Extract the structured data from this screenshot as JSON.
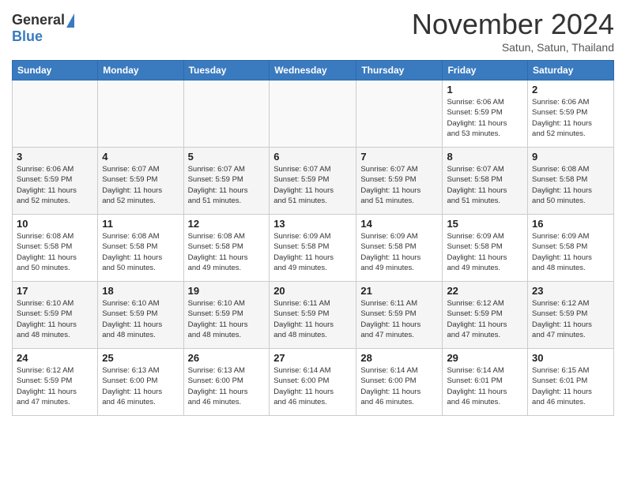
{
  "header": {
    "logo_general": "General",
    "logo_blue": "Blue",
    "month_title": "November 2024",
    "subtitle": "Satun, Satun, Thailand"
  },
  "weekdays": [
    "Sunday",
    "Monday",
    "Tuesday",
    "Wednesday",
    "Thursday",
    "Friday",
    "Saturday"
  ],
  "weeks": [
    [
      {
        "num": "",
        "info": ""
      },
      {
        "num": "",
        "info": ""
      },
      {
        "num": "",
        "info": ""
      },
      {
        "num": "",
        "info": ""
      },
      {
        "num": "",
        "info": ""
      },
      {
        "num": "1",
        "info": "Sunrise: 6:06 AM\nSunset: 5:59 PM\nDaylight: 11 hours\nand 53 minutes."
      },
      {
        "num": "2",
        "info": "Sunrise: 6:06 AM\nSunset: 5:59 PM\nDaylight: 11 hours\nand 52 minutes."
      }
    ],
    [
      {
        "num": "3",
        "info": "Sunrise: 6:06 AM\nSunset: 5:59 PM\nDaylight: 11 hours\nand 52 minutes."
      },
      {
        "num": "4",
        "info": "Sunrise: 6:07 AM\nSunset: 5:59 PM\nDaylight: 11 hours\nand 52 minutes."
      },
      {
        "num": "5",
        "info": "Sunrise: 6:07 AM\nSunset: 5:59 PM\nDaylight: 11 hours\nand 51 minutes."
      },
      {
        "num": "6",
        "info": "Sunrise: 6:07 AM\nSunset: 5:59 PM\nDaylight: 11 hours\nand 51 minutes."
      },
      {
        "num": "7",
        "info": "Sunrise: 6:07 AM\nSunset: 5:59 PM\nDaylight: 11 hours\nand 51 minutes."
      },
      {
        "num": "8",
        "info": "Sunrise: 6:07 AM\nSunset: 5:58 PM\nDaylight: 11 hours\nand 51 minutes."
      },
      {
        "num": "9",
        "info": "Sunrise: 6:08 AM\nSunset: 5:58 PM\nDaylight: 11 hours\nand 50 minutes."
      }
    ],
    [
      {
        "num": "10",
        "info": "Sunrise: 6:08 AM\nSunset: 5:58 PM\nDaylight: 11 hours\nand 50 minutes."
      },
      {
        "num": "11",
        "info": "Sunrise: 6:08 AM\nSunset: 5:58 PM\nDaylight: 11 hours\nand 50 minutes."
      },
      {
        "num": "12",
        "info": "Sunrise: 6:08 AM\nSunset: 5:58 PM\nDaylight: 11 hours\nand 49 minutes."
      },
      {
        "num": "13",
        "info": "Sunrise: 6:09 AM\nSunset: 5:58 PM\nDaylight: 11 hours\nand 49 minutes."
      },
      {
        "num": "14",
        "info": "Sunrise: 6:09 AM\nSunset: 5:58 PM\nDaylight: 11 hours\nand 49 minutes."
      },
      {
        "num": "15",
        "info": "Sunrise: 6:09 AM\nSunset: 5:58 PM\nDaylight: 11 hours\nand 49 minutes."
      },
      {
        "num": "16",
        "info": "Sunrise: 6:09 AM\nSunset: 5:58 PM\nDaylight: 11 hours\nand 48 minutes."
      }
    ],
    [
      {
        "num": "17",
        "info": "Sunrise: 6:10 AM\nSunset: 5:59 PM\nDaylight: 11 hours\nand 48 minutes."
      },
      {
        "num": "18",
        "info": "Sunrise: 6:10 AM\nSunset: 5:59 PM\nDaylight: 11 hours\nand 48 minutes."
      },
      {
        "num": "19",
        "info": "Sunrise: 6:10 AM\nSunset: 5:59 PM\nDaylight: 11 hours\nand 48 minutes."
      },
      {
        "num": "20",
        "info": "Sunrise: 6:11 AM\nSunset: 5:59 PM\nDaylight: 11 hours\nand 48 minutes."
      },
      {
        "num": "21",
        "info": "Sunrise: 6:11 AM\nSunset: 5:59 PM\nDaylight: 11 hours\nand 47 minutes."
      },
      {
        "num": "22",
        "info": "Sunrise: 6:12 AM\nSunset: 5:59 PM\nDaylight: 11 hours\nand 47 minutes."
      },
      {
        "num": "23",
        "info": "Sunrise: 6:12 AM\nSunset: 5:59 PM\nDaylight: 11 hours\nand 47 minutes."
      }
    ],
    [
      {
        "num": "24",
        "info": "Sunrise: 6:12 AM\nSunset: 5:59 PM\nDaylight: 11 hours\nand 47 minutes."
      },
      {
        "num": "25",
        "info": "Sunrise: 6:13 AM\nSunset: 6:00 PM\nDaylight: 11 hours\nand 46 minutes."
      },
      {
        "num": "26",
        "info": "Sunrise: 6:13 AM\nSunset: 6:00 PM\nDaylight: 11 hours\nand 46 minutes."
      },
      {
        "num": "27",
        "info": "Sunrise: 6:14 AM\nSunset: 6:00 PM\nDaylight: 11 hours\nand 46 minutes."
      },
      {
        "num": "28",
        "info": "Sunrise: 6:14 AM\nSunset: 6:00 PM\nDaylight: 11 hours\nand 46 minutes."
      },
      {
        "num": "29",
        "info": "Sunrise: 6:14 AM\nSunset: 6:01 PM\nDaylight: 11 hours\nand 46 minutes."
      },
      {
        "num": "30",
        "info": "Sunrise: 6:15 AM\nSunset: 6:01 PM\nDaylight: 11 hours\nand 46 minutes."
      }
    ]
  ]
}
